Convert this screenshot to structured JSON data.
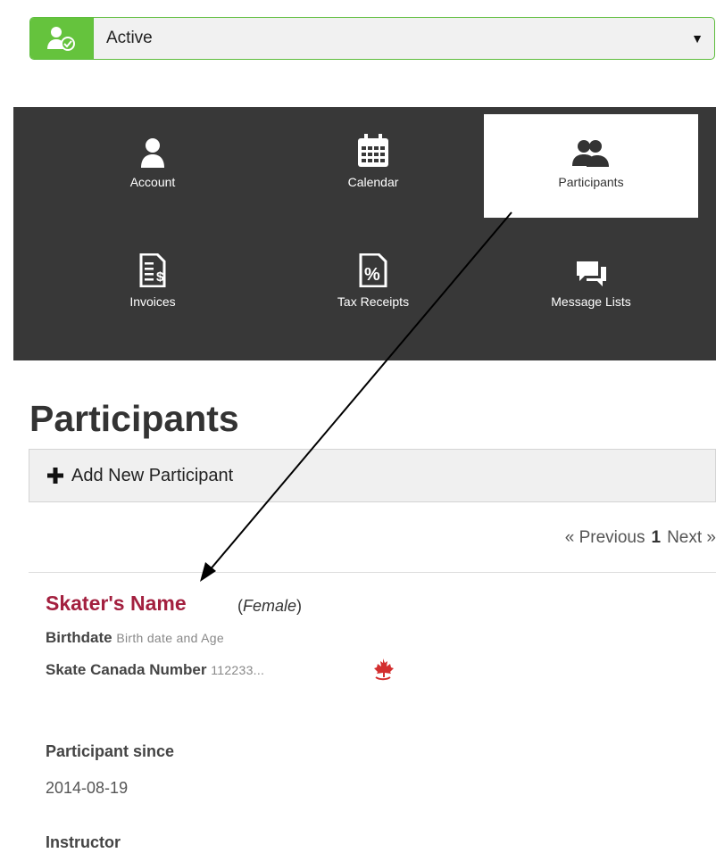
{
  "status": {
    "selected": "Active",
    "icon": "user-check-icon"
  },
  "nav": {
    "items": [
      {
        "label": "Account",
        "icon": "user-icon"
      },
      {
        "label": "Calendar",
        "icon": "calendar-icon"
      },
      {
        "label": "Participants",
        "icon": "users-icon",
        "active": true
      },
      {
        "label": "Invoices",
        "icon": "invoice-icon"
      },
      {
        "label": "Tax Receipts",
        "icon": "percent-doc-icon"
      },
      {
        "label": "Message Lists",
        "icon": "chat-icon"
      }
    ]
  },
  "page": {
    "title": "Participants",
    "add_label": "Add New Participant"
  },
  "pager": {
    "prev": "« Previous",
    "current": "1",
    "next": "Next »"
  },
  "participant": {
    "name": "Skater's Name",
    "gender": "Female",
    "birthdate_label": "Birthdate",
    "birthdate_value": "Birth date and Age",
    "skate_label": "Skate Canada Number",
    "skate_value": "112233...",
    "since_label": "Participant since",
    "since_value": "2014-08-19",
    "instructor_label": "Instructor"
  },
  "colors": {
    "accent": "#65c33d",
    "nav_bg": "#383838",
    "name": "#a3203f",
    "maple": "#d32f2f"
  }
}
